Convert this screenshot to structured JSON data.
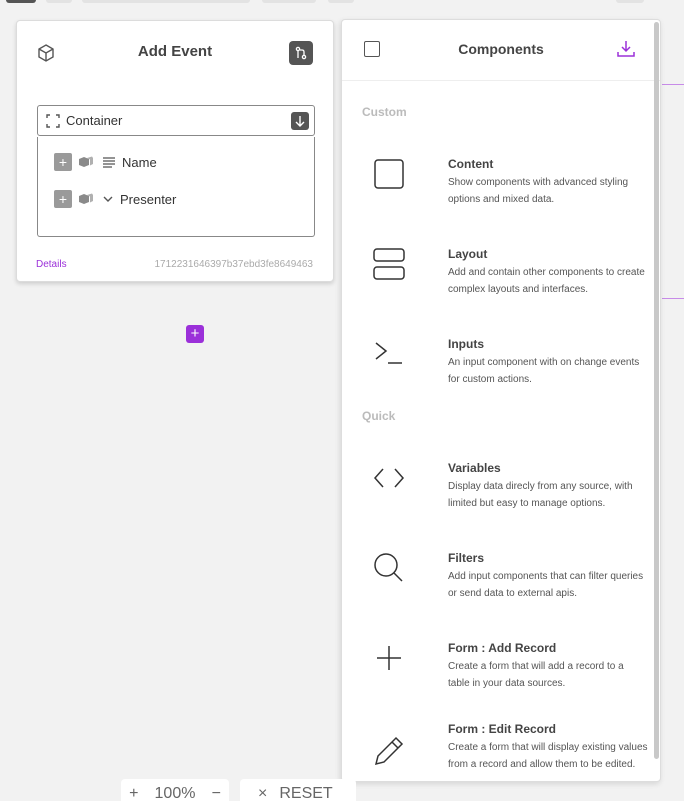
{
  "event_card": {
    "title": "Add Event",
    "container_label": "Container",
    "tree_items": [
      {
        "label": "Name"
      },
      {
        "label": "Presenter"
      }
    ],
    "details_link": "Details",
    "event_id": "1712231646397b37ebd3fe8649463"
  },
  "components_panel": {
    "title": "Components",
    "sections": {
      "custom": "Custom",
      "quick": "Quick"
    },
    "items": [
      {
        "name": "Content",
        "description": "Show components with advanced styling options and mixed data.",
        "icon": "square-icon"
      },
      {
        "name": "Layout",
        "description": "Add and contain other components to create complex layouts and interfaces.",
        "icon": "layout-icon"
      },
      {
        "name": "Inputs",
        "description": "An input component with on change events for custom actions.",
        "icon": "terminal-icon"
      },
      {
        "name": "Variables",
        "description": "Display data direcly from any source, with limited but easy to manage options.",
        "icon": "code-icon"
      },
      {
        "name": "Filters",
        "description": "Add input components that can filter queries or send data to external apis.",
        "icon": "search-icon"
      },
      {
        "name": "Form : Add Record",
        "description": "Create a form that will add a record to a table in your data sources.",
        "icon": "plus-icon"
      },
      {
        "name": "Form : Edit Record",
        "description": "Create a form that will display existing values from a record and allow them to be edited.",
        "icon": "pencil-icon"
      }
    ]
  },
  "zoom": {
    "plus": "+",
    "level": "100%",
    "minus": "−"
  },
  "reset": {
    "x": "×",
    "label": "RESET"
  },
  "colors": {
    "accent": "#9b30d9",
    "dark_button": "#555555"
  }
}
